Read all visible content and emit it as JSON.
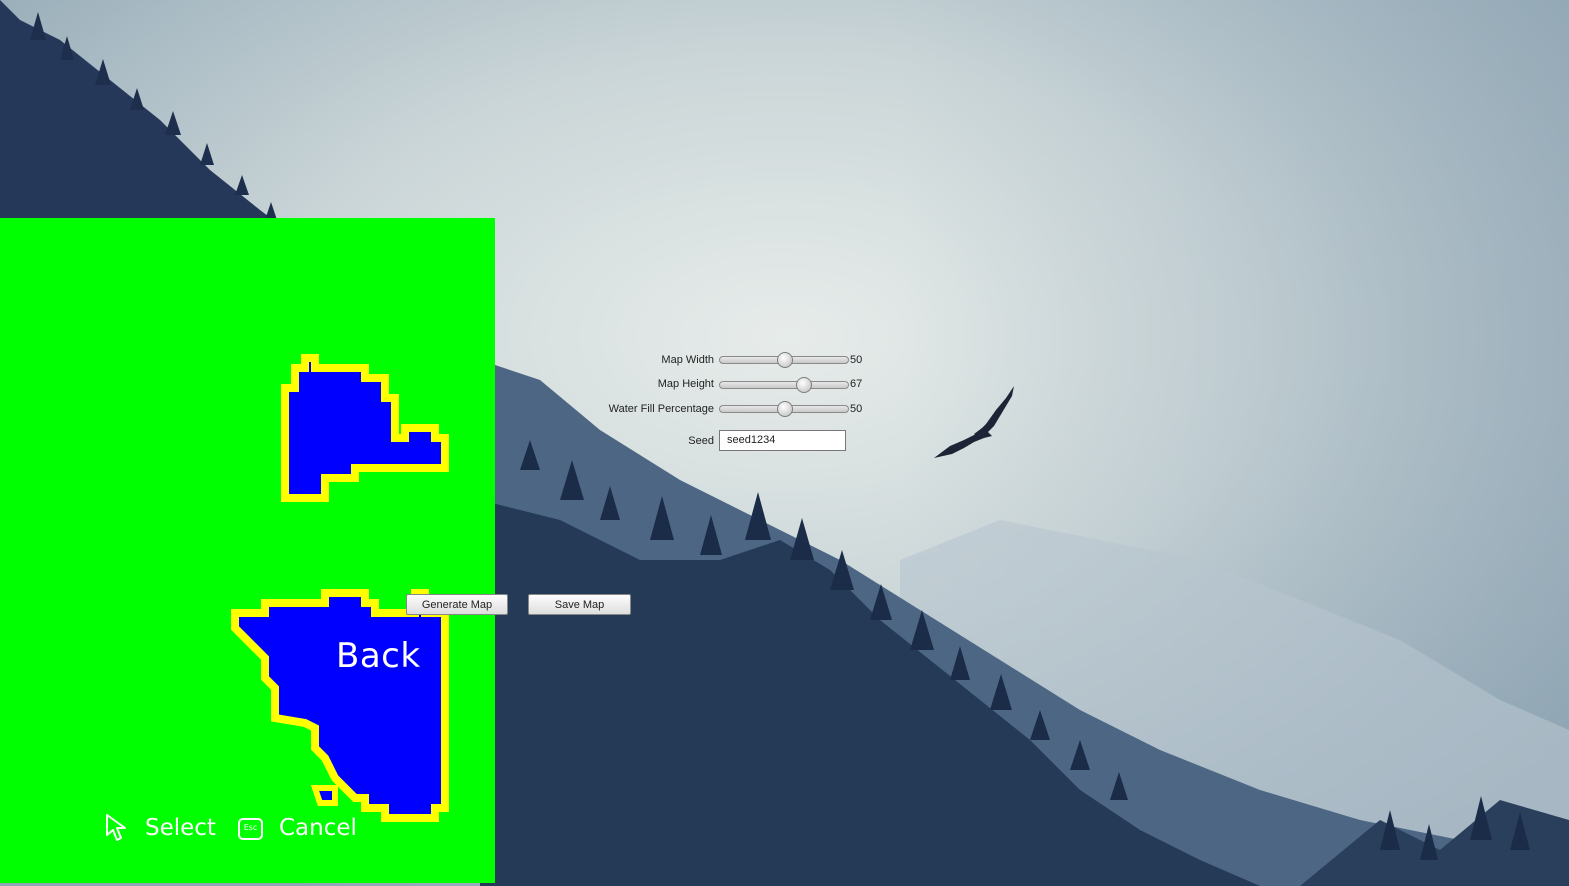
{
  "controls": {
    "map_width": {
      "label": "Map Width",
      "value": "50",
      "fill": 0.5
    },
    "map_height": {
      "label": "Map Height",
      "value": "67",
      "fill": 0.65
    },
    "water_fill": {
      "label": "Water Fill Percentage",
      "value": "50",
      "fill": 0.5
    },
    "seed": {
      "label": "Seed",
      "value": "seed1234"
    }
  },
  "buttons": {
    "generate": "Generate Map",
    "save": "Save Map"
  },
  "menu": {
    "back": "Back"
  },
  "hints": {
    "select": "Select",
    "cancel": "Cancel",
    "cancel_key": "Esc"
  },
  "colors": {
    "land": "#00ff00",
    "water": "#0000ff",
    "shore": "#ffff00"
  },
  "icons": [
    "cursor-icon",
    "esc-key-icon",
    "eagle-icon"
  ]
}
